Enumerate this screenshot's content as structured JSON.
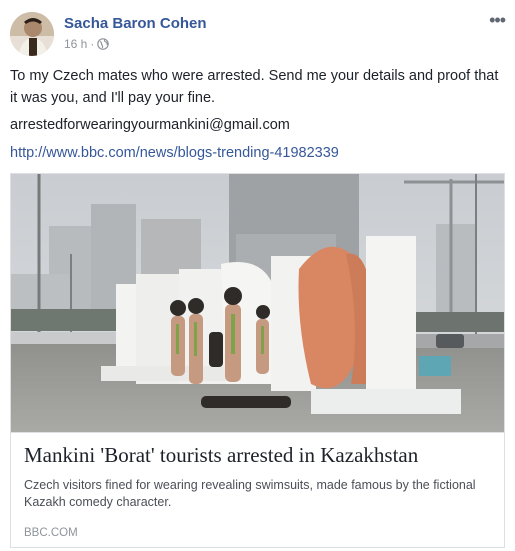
{
  "post": {
    "author": "Sacha Baron Cohen",
    "time": "16 h",
    "separator": "·",
    "more_glyph": "•••",
    "text": "To my Czech mates who were arrested. Send me your details and proof that it was you, and I'll pay your fine.",
    "email": "arrestedforwearingyourmankini@gmail.com",
    "link": "http://www.bbc.com/news/blogs-trending-41982339"
  },
  "card": {
    "title": "Mankini 'Borat' tourists arrested in Kazakhstan",
    "description": "Czech visitors fined for wearing revealing swimsuits, made famous by the fictional Kazakh comedy character.",
    "domain": "BBC.COM"
  },
  "icons": {
    "privacy": "globe-icon",
    "menu": "more-options-icon"
  },
  "colors": {
    "author_link": "#365899",
    "meta_text": "#90949c",
    "border": "#dddfe2",
    "text": "#1d2129"
  }
}
